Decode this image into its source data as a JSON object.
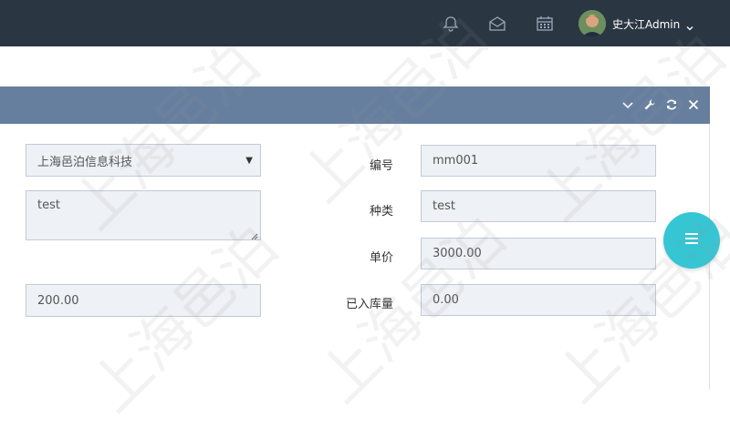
{
  "header": {
    "icons": [
      "bell-icon",
      "envelope-icon",
      "calendar-icon"
    ],
    "user_name": "史大江Admin"
  },
  "panel": {
    "tools": [
      "chevron-down-icon",
      "wrench-icon",
      "refresh-icon",
      "close-icon"
    ]
  },
  "form": {
    "company_value": "上海邑泊信息科技",
    "notes_value": "test",
    "amount_value": "200.00",
    "code_label": "编号",
    "code_value": "mm001",
    "category_label": "种类",
    "category_value": "test",
    "unit_price_label": "单价",
    "unit_price_value": "3000.00",
    "stocked_label": "已入库量",
    "stocked_value": "0.00"
  },
  "watermark_text": "上海邑泊",
  "colors": {
    "topbar": "#2b3643",
    "panel_header": "#677f9f",
    "fab": "#36c6d3"
  }
}
